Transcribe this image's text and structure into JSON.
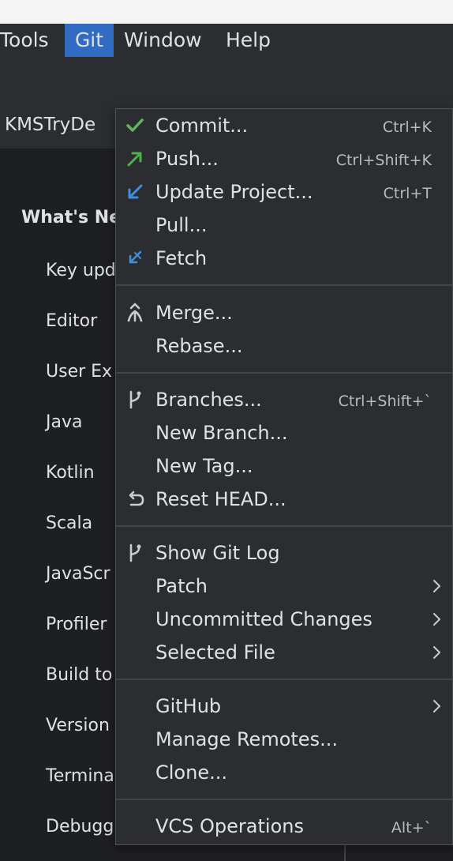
{
  "menubar": {
    "tools": "Tools",
    "git": "Git",
    "window": "Window",
    "help": "Help"
  },
  "project": {
    "name": "KMSTryDe"
  },
  "whats_new": {
    "heading": "What's Ne",
    "items": [
      "Key upd",
      "Editor",
      "User Ex",
      "Java",
      "Kotlin",
      "Scala",
      "JavaScr",
      "Profiler",
      "Build to",
      "Version",
      "Termina",
      "Debugg"
    ]
  },
  "git_menu": {
    "commit": {
      "label": "Commit...",
      "shortcut": "Ctrl+K"
    },
    "push": {
      "label": "Push...",
      "shortcut": "Ctrl+Shift+K"
    },
    "update_project": {
      "label": "Update Project...",
      "shortcut": "Ctrl+T"
    },
    "pull": {
      "label": "Pull..."
    },
    "fetch": {
      "label": "Fetch"
    },
    "merge": {
      "label": "Merge..."
    },
    "rebase": {
      "label": "Rebase..."
    },
    "branches": {
      "label": "Branches...",
      "shortcut": "Ctrl+Shift+`"
    },
    "new_branch": {
      "label": "New Branch..."
    },
    "new_tag": {
      "label": "New Tag..."
    },
    "reset_head": {
      "label": "Reset HEAD..."
    },
    "show_git_log": {
      "label": "Show Git Log"
    },
    "patch": {
      "label": "Patch"
    },
    "uncommitted_changes": {
      "label": "Uncommitted Changes"
    },
    "selected_file": {
      "label": "Selected File"
    },
    "github": {
      "label": "GitHub"
    },
    "manage_remotes": {
      "label": "Manage Remotes..."
    },
    "clone": {
      "label": "Clone..."
    },
    "vcs_operations": {
      "label": "VCS Operations",
      "shortcut": "Alt+`"
    }
  },
  "colors": {
    "menu_bg": "#2b2d30",
    "highlight": "#2f6cc2",
    "commit_icon": "#5fb85f",
    "push_icon": "#4caf50",
    "update_icon": "#3d8fe0",
    "fetch_icon": "#3d8fe0"
  },
  "icons": {
    "commit": "check-icon",
    "push": "arrow-up-right-icon",
    "update": "arrow-down-left-icon",
    "fetch": "fetch-arrow-icon",
    "merge": "merge-icon",
    "branches": "branch-icon",
    "reset": "undo-icon",
    "log": "branch-icon",
    "submenu": "chevron-right-icon"
  }
}
